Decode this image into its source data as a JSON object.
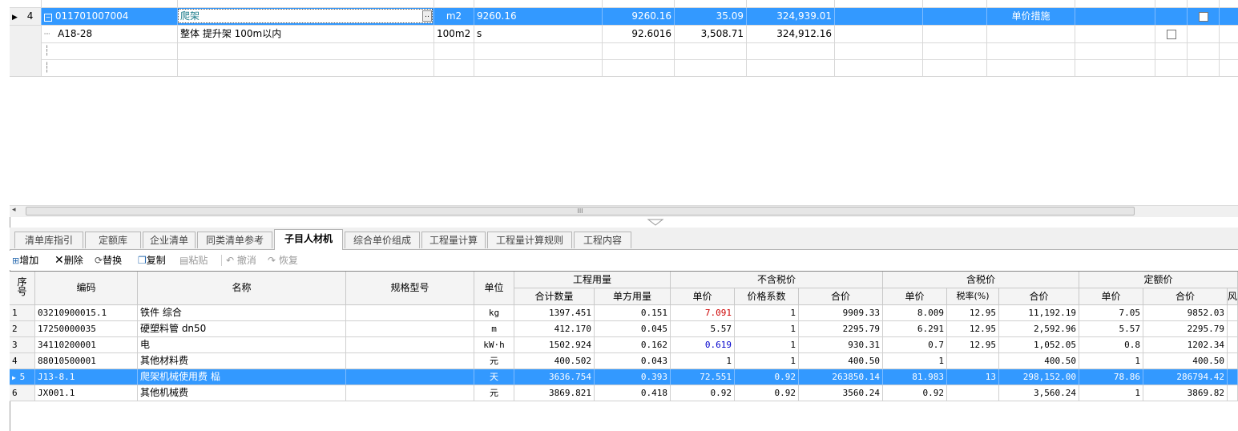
{
  "upper_grid": {
    "rows": [
      {
        "num": "4",
        "code": "011701007004",
        "name": "爬架",
        "unit": "m2",
        "qty": "9260.16",
        "qty2": "9260.16",
        "price": "35.09",
        "total": "324,939.01",
        "category": "单价措施",
        "checked": false,
        "selected": true
      },
      {
        "num": "",
        "code": "A18-28",
        "name": "整体 提升架 100m以内",
        "unit": "100m2",
        "qty": "s",
        "qty2": "92.6016",
        "price": "3,508.71",
        "total": "324,912.16",
        "category": "",
        "checked": false,
        "selected": false
      }
    ],
    "scroll_mark": "III"
  },
  "tabs": [
    "清单库指引",
    "定额库",
    "企业清单",
    "同类清单参考",
    "子目人材机",
    "综合单价组成",
    "工程量计算",
    "工程量计算规则",
    "工程内容"
  ],
  "active_tab": 4,
  "toolbar": {
    "add": "增加",
    "delete": "删除",
    "replace": "替换",
    "copy": "复制",
    "paste": "粘贴",
    "undo": "撤消",
    "redo": "恢复"
  },
  "lower_grid": {
    "headers": {
      "seq": "序号",
      "code": "编码",
      "name": "名称",
      "spec": "规格型号",
      "unit": "单位",
      "group_qty": "工程用量",
      "qty_total": "合计数量",
      "qty_unit": "单方用量",
      "group_notax": "不含税价",
      "nt_price": "单价",
      "nt_coef": "价格系数",
      "nt_total": "合价",
      "group_tax": "含税价",
      "t_price": "单价",
      "t_rate": "税率(%)",
      "t_total": "合价",
      "group_quota": "定额价",
      "q_price": "单价",
      "q_total": "合价",
      "extra": "风"
    },
    "rows": [
      {
        "seq": "1",
        "code": "03210900015.1",
        "name": "铁件 综合",
        "spec": "",
        "unit": "kg",
        "qty_total": "1397.451",
        "qty_unit": "0.151",
        "nt_price": "7.091",
        "nt_coef": "1",
        "nt_total": "9909.33",
        "t_price": "8.009",
        "t_rate": "12.95",
        "t_total": "11,192.19",
        "q_price": "7.05",
        "q_total": "9852.03",
        "price_color": "#cc0000",
        "selected": false
      },
      {
        "seq": "2",
        "code": "17250000035",
        "name": "硬塑料管 dn50",
        "spec": "",
        "unit": "m",
        "qty_total": "412.170",
        "qty_unit": "0.045",
        "nt_price": "5.57",
        "nt_coef": "1",
        "nt_total": "2295.79",
        "t_price": "6.291",
        "t_rate": "12.95",
        "t_total": "2,592.96",
        "q_price": "5.57",
        "q_total": "2295.79",
        "price_color": "#000000",
        "selected": false
      },
      {
        "seq": "3",
        "code": "34110200001",
        "name": "电",
        "spec": "",
        "unit": "kW·h",
        "qty_total": "1502.924",
        "qty_unit": "0.162",
        "nt_price": "0.619",
        "nt_coef": "1",
        "nt_total": "930.31",
        "t_price": "0.7",
        "t_rate": "12.95",
        "t_total": "1,052.05",
        "q_price": "0.8",
        "q_total": "1202.34",
        "price_color": "#0000cc",
        "selected": false
      },
      {
        "seq": "4",
        "code": "88010500001",
        "name": "其他材料费",
        "spec": "",
        "unit": "元",
        "qty_total": "400.502",
        "qty_unit": "0.043",
        "nt_price": "1",
        "nt_coef": "1",
        "nt_total": "400.50",
        "t_price": "1",
        "t_rate": "",
        "t_total": "400.50",
        "q_price": "1",
        "q_total": "400.50",
        "price_color": "#000000",
        "selected": false
      },
      {
        "seq": "5",
        "code": "J13-8.1",
        "name": "爬架机械使用费 榀",
        "spec": "",
        "unit": "天",
        "qty_total": "3636.754",
        "qty_unit": "0.393",
        "nt_price": "72.551",
        "nt_coef": "0.92",
        "nt_total": "263850.14",
        "t_price": "81.983",
        "t_rate": "13",
        "t_total": "298,152.00",
        "q_price": "78.86",
        "q_total": "286794.42",
        "price_color": "#ffffff",
        "selected": true
      },
      {
        "seq": "6",
        "code": "JX001.1",
        "name": "其他机械费",
        "spec": "",
        "unit": "元",
        "qty_total": "3869.821",
        "qty_unit": "0.418",
        "nt_price": "0.92",
        "nt_coef": "0.92",
        "nt_total": "3560.24",
        "t_price": "0.92",
        "t_rate": "",
        "t_total": "3,560.24",
        "q_price": "1",
        "q_total": "3869.82",
        "price_color": "#000000",
        "selected": false
      }
    ]
  },
  "colors": {
    "selection": "#3399ff",
    "header_bg": "#f4f4f4",
    "grid_line": "#d0d0d0"
  }
}
